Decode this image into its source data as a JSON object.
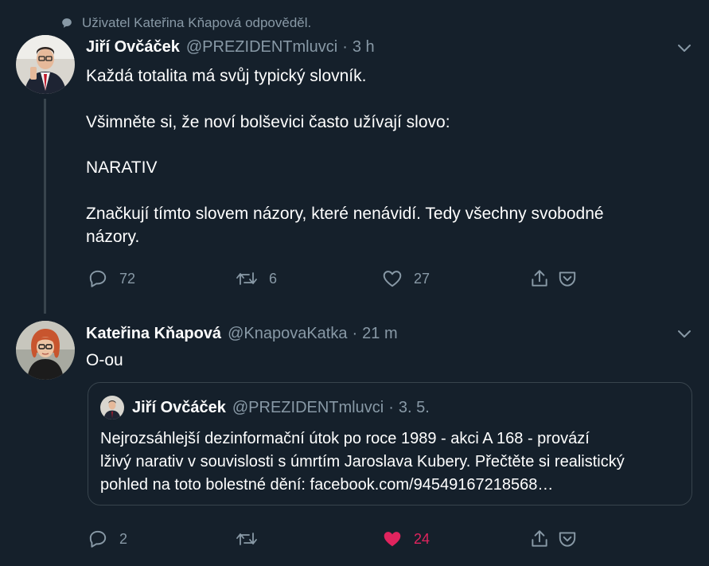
{
  "context": {
    "text": "Uživatel Kateřina Kňapová odpověděl."
  },
  "tweet1": {
    "name": "Jiří Ovčáček",
    "handle": "@PREZIDENTmluvci",
    "time": "3 h",
    "lines": [
      "Každá totalita má svůj typický slovník.",
      "Všimněte si, že noví bolševici často užívají slovo:",
      "NARATIV",
      "Značkují tímto slovem názory, které nenávidí. Tedy všechny svobodné",
      "názory."
    ],
    "replies": "72",
    "retweets": "6",
    "likes": "27"
  },
  "tweet2": {
    "name": "Kateřina Kňapová",
    "handle": "@KnapovaKatka",
    "time": "21 m",
    "text": "O-ou",
    "replies": "2",
    "retweets": "",
    "likes": "24",
    "liked": true
  },
  "quote": {
    "name": "Jiří Ovčáček",
    "handle": "@PREZIDENTmluvci",
    "date": "3. 5.",
    "lines": [
      "Nejrozsáhlejší dezinformační útok po roce 1989 - akci A 168 - provází",
      "lživý narativ v souvislosti s úmrtím Jaroslava Kubery. Přečtěte si realistický",
      "pohled na toto bolestné dění: facebook.com/94549167218568…"
    ]
  },
  "colors": {
    "background": "#15202b",
    "muted": "#8899a6",
    "border": "#38444d",
    "like": "#e0245e"
  }
}
